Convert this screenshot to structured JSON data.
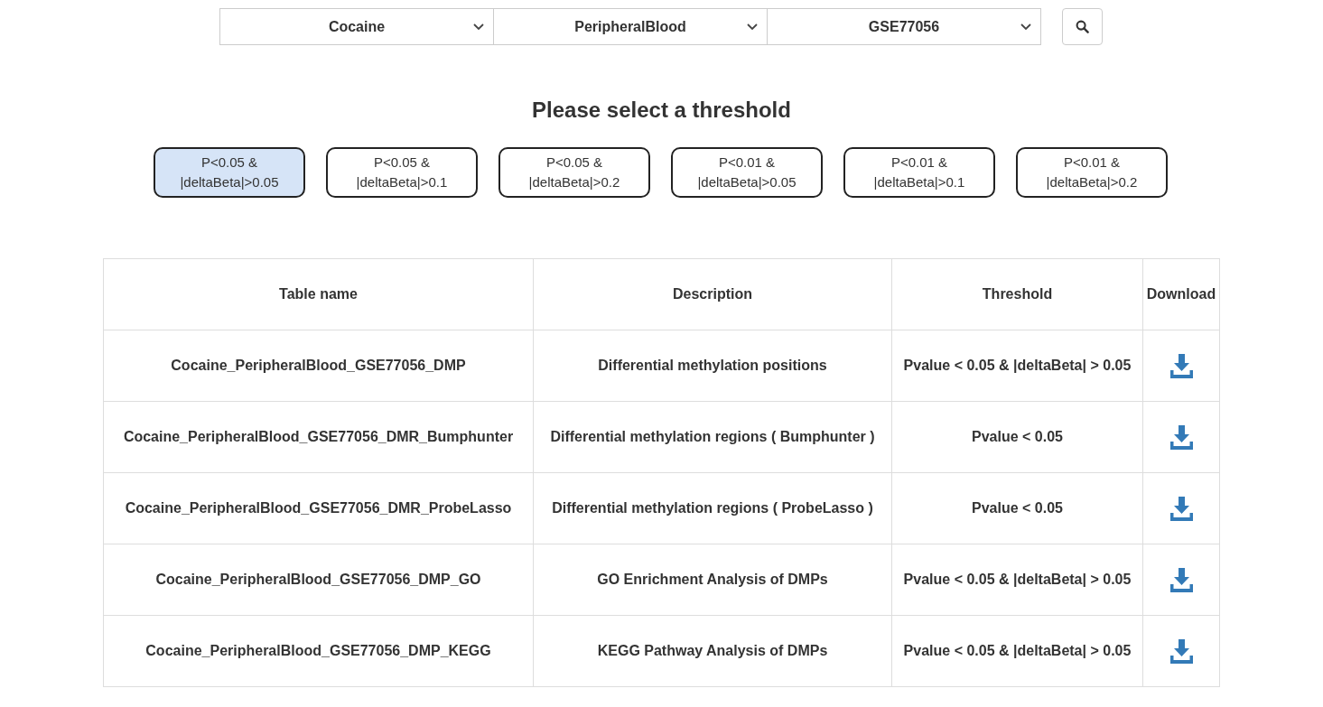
{
  "selects": [
    {
      "value": "Cocaine"
    },
    {
      "value": "PeripheralBlood"
    },
    {
      "value": "GSE77056"
    }
  ],
  "heading": "Please select a threshold",
  "thresholds": [
    {
      "label": "P<0.05 & |deltaBeta|>0.05",
      "selected": true
    },
    {
      "label": "P<0.05 & |deltaBeta|>0.1",
      "selected": false
    },
    {
      "label": "P<0.05 & |deltaBeta|>0.2",
      "selected": false
    },
    {
      "label": "P<0.01 & |deltaBeta|>0.05",
      "selected": false
    },
    {
      "label": "P<0.01 & |deltaBeta|>0.1",
      "selected": false
    },
    {
      "label": "P<0.01 & |deltaBeta|>0.2",
      "selected": false
    }
  ],
  "table": {
    "columns": [
      "Table name",
      "Description",
      "Threshold",
      "Download"
    ],
    "rows": [
      [
        "Cocaine_PeripheralBlood_GSE77056_DMP",
        "Differential methylation positions",
        "Pvalue < 0.05 & |deltaBeta| > 0.05"
      ],
      [
        "Cocaine_PeripheralBlood_GSE77056_DMR_Bumphunter",
        "Differential methylation regions ( Bumphunter )",
        "Pvalue < 0.05"
      ],
      [
        "Cocaine_PeripheralBlood_GSE77056_DMR_ProbeLasso",
        "Differential methylation regions ( ProbeLasso )",
        "Pvalue < 0.05"
      ],
      [
        "Cocaine_PeripheralBlood_GSE77056_DMP_GO",
        "GO Enrichment Analysis of DMPs",
        "Pvalue < 0.05 & |deltaBeta| > 0.05"
      ],
      [
        "Cocaine_PeripheralBlood_GSE77056_DMP_KEGG",
        "KEGG Pathway Analysis of DMPs",
        "Pvalue < 0.05 & |deltaBeta| > 0.05"
      ]
    ]
  }
}
